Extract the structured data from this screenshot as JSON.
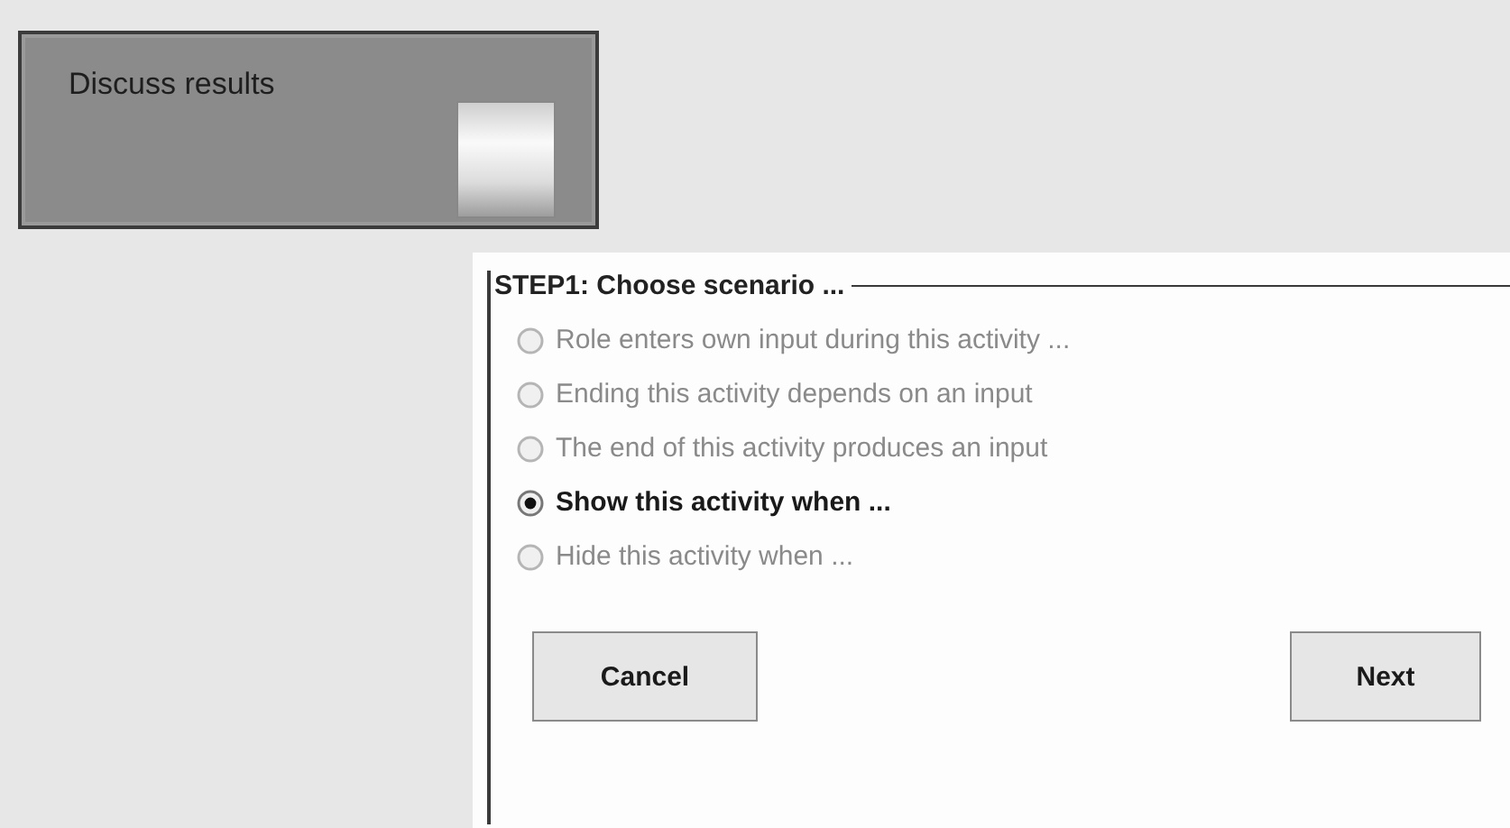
{
  "activity": {
    "label": "Discuss results"
  },
  "scenario": {
    "title": "STEP1: Choose scenario ...",
    "options": [
      {
        "label": "Role enters own input during this activity ...",
        "selected": false
      },
      {
        "label": "Ending this activity depends on an input",
        "selected": false
      },
      {
        "label": "The end of this activity produces an input",
        "selected": false
      },
      {
        "label": "Show this activity when ...",
        "selected": true
      },
      {
        "label": "Hide this activity when ...",
        "selected": false
      }
    ],
    "buttons": [
      "Cancel",
      "Next"
    ]
  }
}
